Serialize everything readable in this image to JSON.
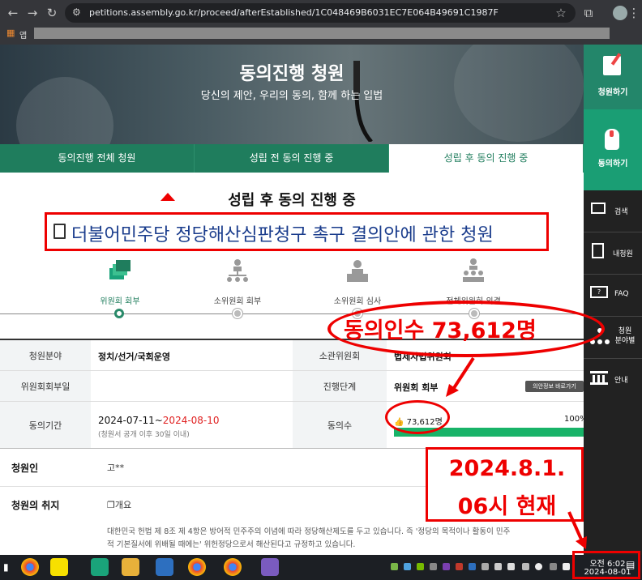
{
  "browser": {
    "url": "petitions.assembly.go.kr/proceed/afterEstablished/1C048469B6031EC7E064B49691C1987F",
    "apps_label": "앱"
  },
  "hero": {
    "title": "동의진행 청원",
    "subtitle": "당신의 제안, 우리의 동의, 함께 하는 입법"
  },
  "tabs": [
    {
      "label": "동의진행 전체 청원"
    },
    {
      "label": "성립 전 동의 진행 중"
    },
    {
      "label": "성립 후 동의 진행 중"
    }
  ],
  "status_title": "성립 후 동의 진행 중",
  "petition_title": "더불어민주당 정당해산심판청구 촉구 결의안에 관한 청원",
  "steps": [
    {
      "label": "위원회 회부"
    },
    {
      "label": "소위원회 회부"
    },
    {
      "label": "소위원회 심사"
    },
    {
      "label": "전체위원회 의결"
    }
  ],
  "table": {
    "field_label": "청원분야",
    "field_value": "정치/선거/국회운영",
    "committee_label": "소관위원회",
    "committee_value": "법제사법위원회",
    "referral_date_label": "위원회회부일",
    "stage_label": "진행단계",
    "stage_value": "위원회 회부",
    "committee_info_button": "의안정보 바로가기",
    "period_label": "동의기간",
    "period_start": "2024-07-11~",
    "period_end": "2024-08-10",
    "period_note": "(청원서 공개 이후 30일 이내)",
    "count_label": "동의수",
    "count_value": "73,612명",
    "progress_text": "100%",
    "progress_fraction": 1.0
  },
  "lower": {
    "petitioner_label": "청원인",
    "petitioner_value": "고**",
    "purpose_label": "청원의 취지",
    "purpose_heading": "❐개요",
    "purpose_line1": "대한민국 헌법 제 8조 제 4항은 방어적 민주주의 이념에 따라 정당해산제도를 두고 있습니다. 즉 '정당의 목적이나 활동이 민주",
    "purpose_line2": "적 기본질서에 위배될 때에는' 위헌정당으로서 해산된다고 규정하고 있습니다."
  },
  "sidebar": {
    "items": [
      {
        "label": "청원하기",
        "icon": "pencil-doc-icon"
      },
      {
        "label": "동의하기",
        "icon": "hand-pointer-icon"
      },
      {
        "label": "검색",
        "icon": "search-monitor-icon"
      },
      {
        "label": "내청원",
        "icon": "my-doc-icon"
      },
      {
        "label": "FAQ",
        "icon": "faq-monitor-icon"
      },
      {
        "label": "청원\n분야별",
        "icon": "org-tree-icon"
      },
      {
        "label": "안내",
        "icon": "building-icon"
      }
    ]
  },
  "annotations": {
    "big_count": "동의인수 73,612명",
    "time_line1": "2024.8.1.",
    "time_line2": "06시 현재"
  },
  "taskbar": {
    "time": "오전 6:02",
    "date": "2024-08-01"
  },
  "colors": {
    "accent_green": "#1f7d5d",
    "annotation_red": "#ee0000",
    "title_blue": "#1a3c8c",
    "period_end_red": "#e02020",
    "progress_green": "#18b368"
  }
}
